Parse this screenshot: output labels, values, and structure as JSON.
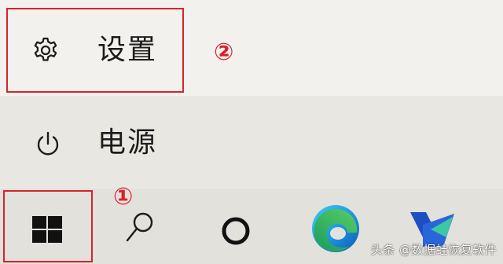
{
  "start_menu": {
    "settings": {
      "label": "设置",
      "icon": "gear-icon"
    },
    "power": {
      "label": "电源",
      "icon": "power-icon"
    }
  },
  "annotations": {
    "step1": "①",
    "step2": "②",
    "color": "#d8232a"
  },
  "taskbar": {
    "items": [
      {
        "name": "start-button",
        "icon": "windows-logo-icon"
      },
      {
        "name": "search-button",
        "icon": "search-icon"
      },
      {
        "name": "cortana-button",
        "icon": "circle-icon"
      },
      {
        "name": "edge-button",
        "icon": "edge-browser-icon"
      },
      {
        "name": "app-button",
        "icon": "app-logo-icon"
      }
    ]
  },
  "watermark": {
    "text": "头条 @数据蛙恢复软件"
  }
}
